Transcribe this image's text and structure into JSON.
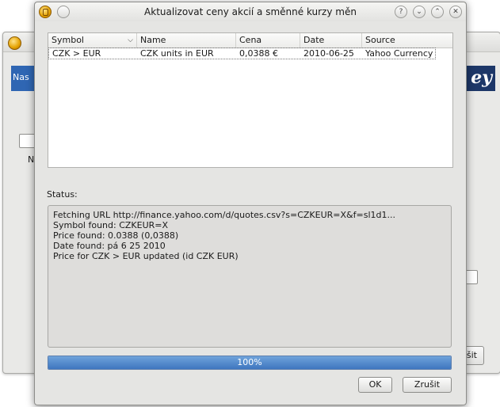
{
  "background_window": {
    "banner_text": "Nas",
    "brand_text": "ey",
    "letter": "N",
    "button_label": "šit"
  },
  "dialog": {
    "title": "Aktualizovat ceny akcií a směnné kurzy měn",
    "controls": {
      "help": "?",
      "minimize": "⌄",
      "maximize": "⌃",
      "close": "✕"
    }
  },
  "table": {
    "columns": [
      "Symbol",
      "Name",
      "Cena",
      "Date",
      "Source"
    ],
    "rows": [
      {
        "symbol": "CZK > EUR",
        "name": "CZK units in EUR",
        "price": "0,0388 €",
        "date": "2010-06-25",
        "source": "Yahoo Currency"
      }
    ]
  },
  "status": {
    "label": "Status:",
    "lines": [
      "Fetching URL http://finance.yahoo.com/d/quotes.csv?s=CZKEUR=X&f=sl1d1...",
      "Symbol found: CZKEUR=X",
      "Price found: 0.0388 (0,0388)",
      "Date found: pá 6 25 2010",
      "Price for CZK > EUR updated (id CZK EUR)"
    ]
  },
  "progress": {
    "value": 1.0,
    "label": "100%"
  },
  "buttons": {
    "ok": "OK",
    "cancel": "Zrušit"
  },
  "colors": {
    "progress": "#3e76bf",
    "banner": "#2f66b3",
    "brand": "#1d3768"
  }
}
